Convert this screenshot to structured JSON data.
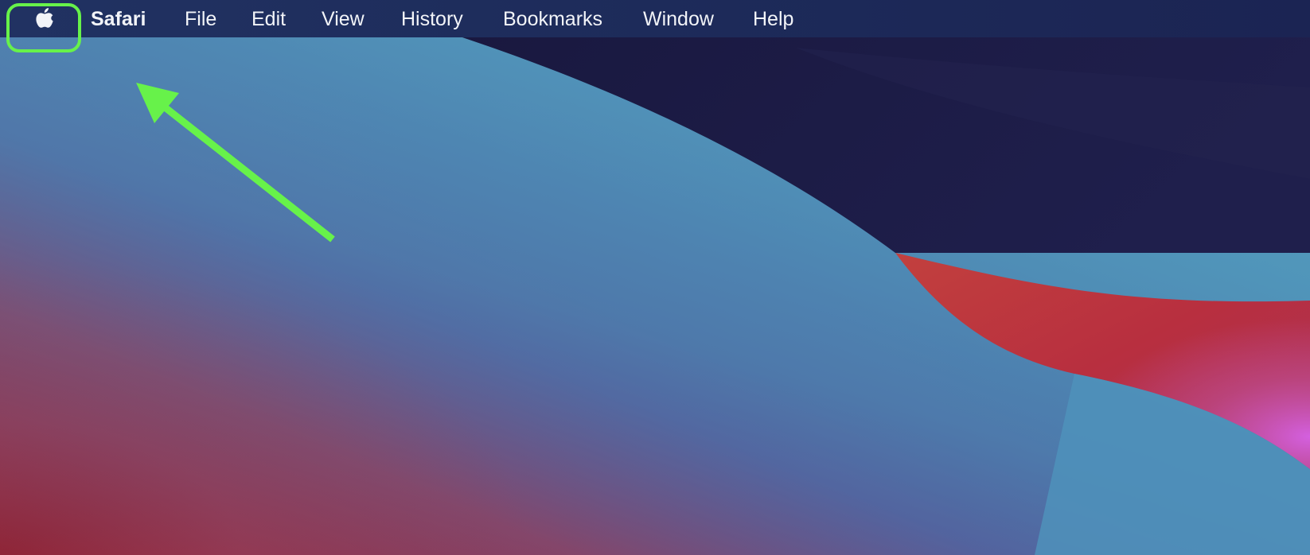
{
  "wallpaper": {
    "name": "macOS Big Sur",
    "colors": {
      "navy": "#1b1b42",
      "teal": "#529fbf",
      "indigo": "#524c98",
      "red": "#c23b3a",
      "crimson": "#9b2e40",
      "magenta": "#c65cc9"
    }
  },
  "menubar": {
    "apple_icon": "apple-logo-icon",
    "app_name": "Safari",
    "items": [
      {
        "label": "File"
      },
      {
        "label": "Edit"
      },
      {
        "label": "View"
      },
      {
        "label": "History"
      },
      {
        "label": "Bookmarks"
      },
      {
        "label": "Window"
      },
      {
        "label": "Help"
      }
    ]
  },
  "annotation": {
    "type": "highlight-arrow",
    "target": "apple-menu",
    "color": "#67f24a"
  }
}
